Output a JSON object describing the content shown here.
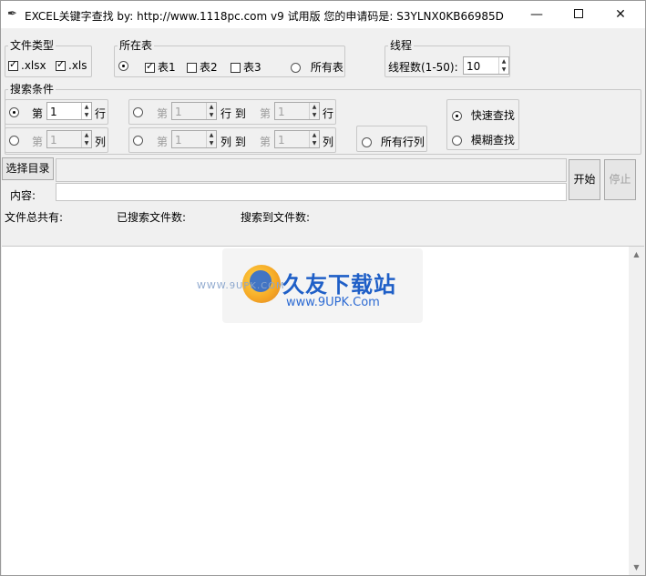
{
  "window": {
    "title": "EXCEL关键字查找  by:  http://www.1118pc.com v9 试用版 您的申请码是: S3YLNX0KB66985D",
    "min_symbol": "—",
    "close_symbol": "✕"
  },
  "file_type": {
    "legend": "文件类型",
    "xlsx_label": ".xlsx",
    "xlsx_checked": true,
    "xls_label": ".xls",
    "xls_checked": true
  },
  "sheet": {
    "legend": "所在表",
    "sheet1_label": "表1",
    "sheet2_label": "表2",
    "sheet3_label": "表3",
    "all_label": "所有表"
  },
  "thread": {
    "legend": "线程",
    "label": "线程数(1-50):",
    "value": "10"
  },
  "search": {
    "legend": "搜索条件",
    "row_prefix": "第",
    "row_value": "1",
    "row_suffix": "行",
    "col_prefix": "第",
    "col_value": "1",
    "col_suffix": "列",
    "range_row_prefix": "第",
    "range_row_from": "1",
    "range_row_mid": "行 到",
    "range_row_prefix2": "第",
    "range_row_to": "1",
    "range_row_suffix": "行",
    "range_col_prefix": "第",
    "range_col_from": "1",
    "range_col_mid": "列 到",
    "range_col_prefix2": "第",
    "range_col_to": "1",
    "range_col_suffix": "列",
    "all_rows_label": "所有行列",
    "fast_label": "快速查找",
    "fuzzy_label": "模糊查找"
  },
  "controls": {
    "choose_dir_label": "选择目录",
    "content_label": "内容:",
    "start_label": "开始",
    "stop_label": "停止"
  },
  "stats": {
    "total_label": "文件总共有:",
    "searched_label": "已搜索文件数:",
    "found_label": "搜索到文件数:"
  },
  "watermark": {
    "cn": "久友下载站",
    "en": "www.9UPK.Com",
    "small": "WWW.9UPK.COM"
  },
  "icons": {
    "app": "feather-icon",
    "scroll_up": "▲",
    "scroll_down": "▼"
  }
}
